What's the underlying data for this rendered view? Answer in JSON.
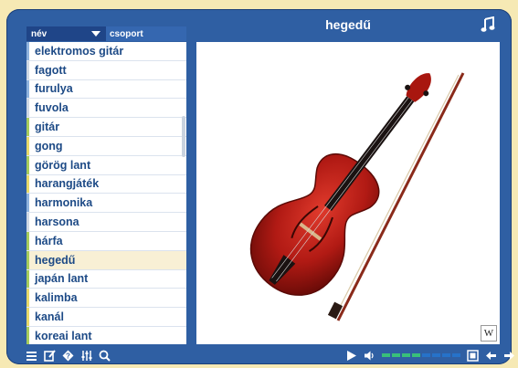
{
  "header": {
    "sort_label": "név",
    "group_label": "csoport"
  },
  "list": [
    {
      "label": "elektromos gitár",
      "mark": "#8fb3de",
      "selected": false
    },
    {
      "label": "fagott",
      "mark": "#cfd8e4",
      "selected": false
    },
    {
      "label": "furulya",
      "mark": "#8fb3de",
      "selected": false
    },
    {
      "label": "fuvola",
      "mark": "#cfd8e4",
      "selected": false
    },
    {
      "label": "gitár",
      "mark": "#a7cc5c",
      "selected": false
    },
    {
      "label": "gong",
      "mark": "#e7d96a",
      "selected": false
    },
    {
      "label": "görög lant",
      "mark": "#a7cc5c",
      "selected": false
    },
    {
      "label": "harangjáték",
      "mark": "#e7d96a",
      "selected": false
    },
    {
      "label": "harmonika",
      "mark": "#8fb3de",
      "selected": false
    },
    {
      "label": "harsona",
      "mark": "#cfd8e4",
      "selected": false
    },
    {
      "label": "hárfa",
      "mark": "#a7cc5c",
      "selected": false
    },
    {
      "label": "hegedű",
      "mark": "#a7cc5c",
      "selected": true
    },
    {
      "label": "japán lant",
      "mark": "#a7cc5c",
      "selected": false
    },
    {
      "label": "kalimba",
      "mark": "#e7d96a",
      "selected": false
    },
    {
      "label": "kanál",
      "mark": "#e7d96a",
      "selected": false
    },
    {
      "label": "koreai lant",
      "mark": "#a7cc5c",
      "selected": false
    }
  ],
  "viewer": {
    "title": "hegedű",
    "credit_logo": "W"
  },
  "colors": {
    "frame": "#2f5fa3",
    "header": "#1f4588",
    "accent": "#f6e9b4",
    "text": "#1d4a86",
    "vol_on": "#39c07a",
    "vol_off": "#2672c9"
  },
  "toolbar": {
    "left_icons": [
      "list-icon",
      "edit-icon",
      "help-icon",
      "filter-icon",
      "search-icon"
    ],
    "right_icons": [
      "play-icon",
      "speaker-icon",
      "fullscreen-icon",
      "prev-arrow-icon",
      "next-arrow-icon"
    ]
  },
  "volume": {
    "levels": 8,
    "active": 4
  }
}
